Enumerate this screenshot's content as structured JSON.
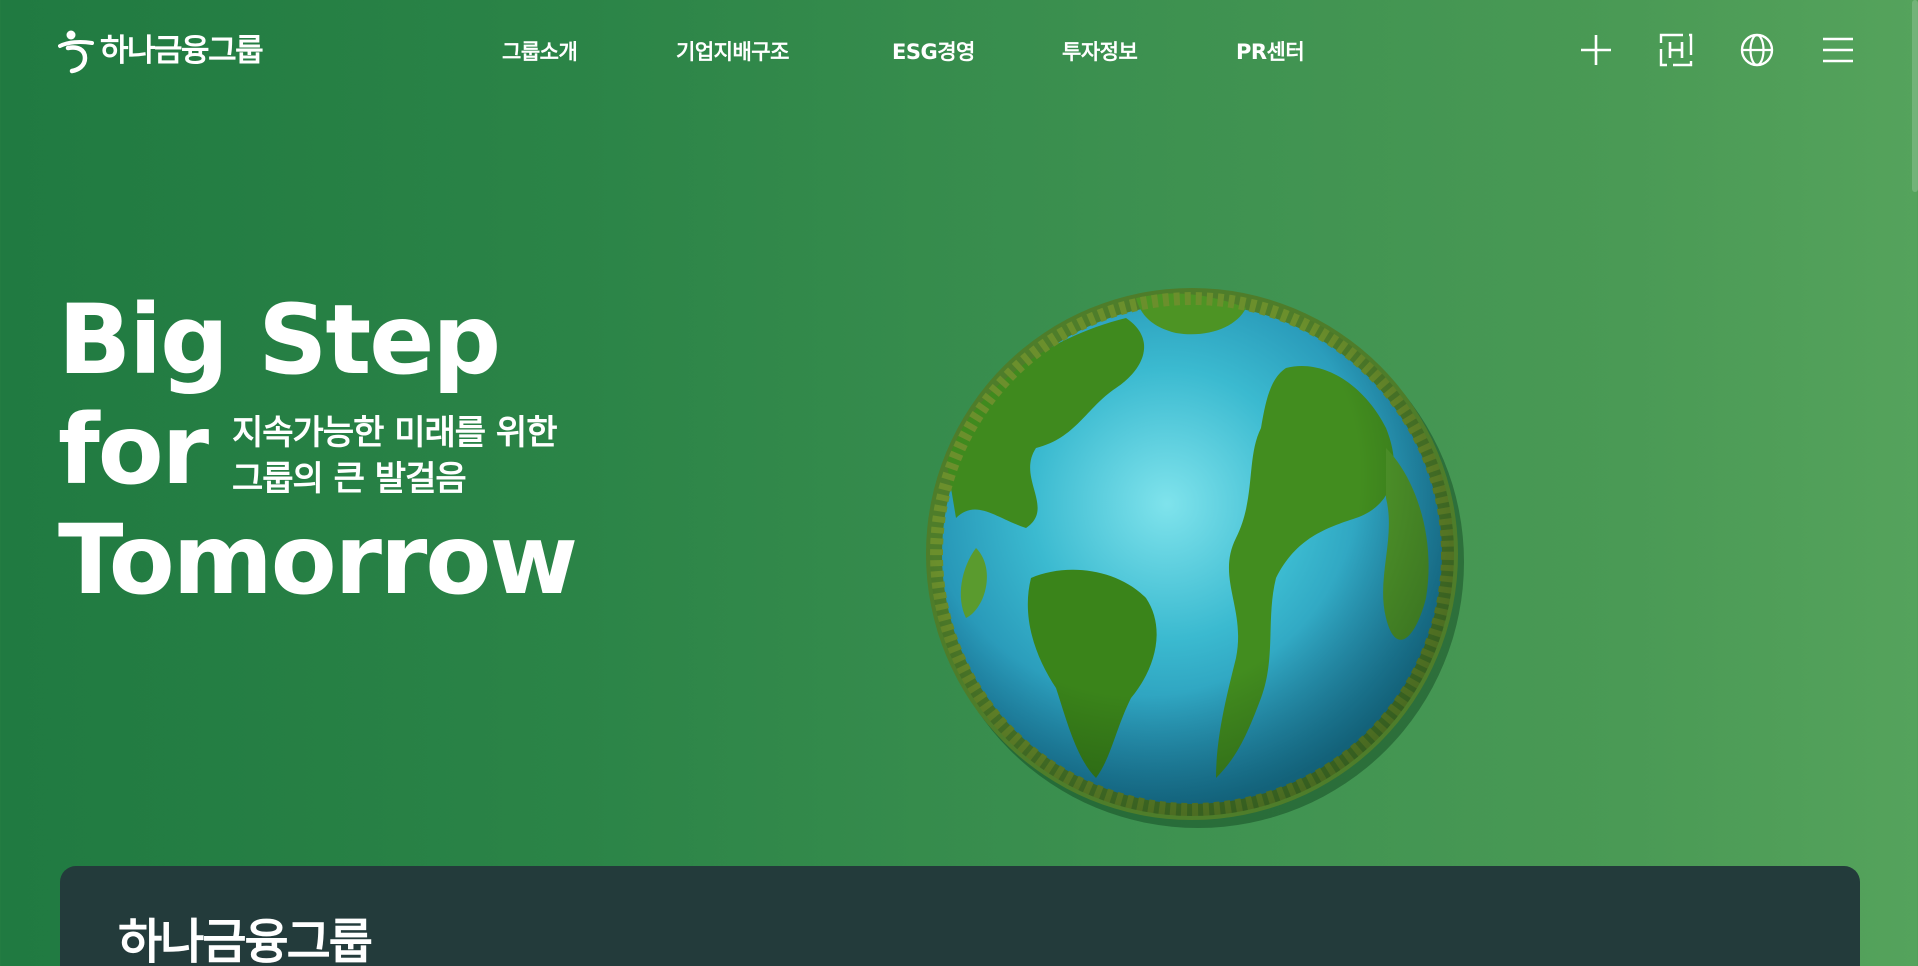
{
  "header": {
    "logo_text": "하나금융그룹",
    "nav": [
      {
        "label": "그룹소개"
      },
      {
        "label": "기업지배구조"
      },
      {
        "label": "ESG경영"
      },
      {
        "label": "투자정보"
      },
      {
        "label": "PR센터"
      }
    ],
    "utility_icons": [
      "plus-icon",
      "h-badge-icon",
      "globe-icon",
      "menu-icon"
    ]
  },
  "hero": {
    "title_line1": "Big Step",
    "title_line2": "for",
    "title_line3": "Tomorrow",
    "subtitle_line1": "지속가능한 미래를 위한",
    "subtitle_line2": "그룹의 큰 발걸음",
    "image": "earth-globe-forest-illustration"
  },
  "section": {
    "title": "하나금융그룹"
  },
  "colors": {
    "background_left": "#207a41",
    "background_right": "#55a35c",
    "card_bg": "#233b3b",
    "text": "#ffffff"
  }
}
